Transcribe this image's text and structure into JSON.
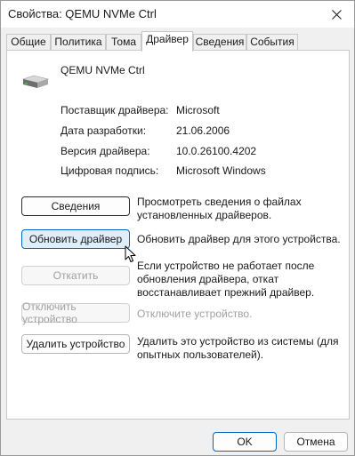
{
  "window": {
    "title": "Свойства: QEMU NVMe Ctrl"
  },
  "tabs": [
    {
      "label": "Общие"
    },
    {
      "label": "Политика"
    },
    {
      "label": "Тома"
    },
    {
      "label": "Драйвер"
    },
    {
      "label": "Сведения"
    },
    {
      "label": "События"
    }
  ],
  "active_tab": "Драйвер",
  "device": {
    "name": "QEMU NVMe Ctrl",
    "icon": "disk-drive-icon"
  },
  "properties": [
    {
      "label": "Поставщик драйвера:",
      "value": "Microsoft"
    },
    {
      "label": "Дата разработки:",
      "value": "21.06.2006"
    },
    {
      "label": "Версия драйвера:",
      "value": "10.0.26100.4202"
    },
    {
      "label": "Цифровая подпись:",
      "value": "Microsoft Windows"
    }
  ],
  "actions": [
    {
      "button": "Сведения",
      "description": "Просмотреть сведения о файлах установленных драйверов.",
      "enabled": true
    },
    {
      "button": "Обновить драйвер",
      "description": "Обновить драйвер для этого устройства.",
      "enabled": true
    },
    {
      "button": "Откатить",
      "description": "Если устройство не работает после обновления драйвера, откат восстанавливает прежний драйвер.",
      "enabled": false
    },
    {
      "button": "Отключить устройство",
      "description": "Отключите устройство.",
      "enabled": false
    },
    {
      "button": "Удалить устройство",
      "description": "Удалить это устройство из системы (для опытных пользователей).",
      "enabled": true
    }
  ],
  "footer": {
    "ok": "OK",
    "cancel": "Отмена"
  },
  "colors": {
    "accent": "#0067c0",
    "hover_bg": "#e0eef9",
    "disabled_text": "#a0a0a0"
  }
}
